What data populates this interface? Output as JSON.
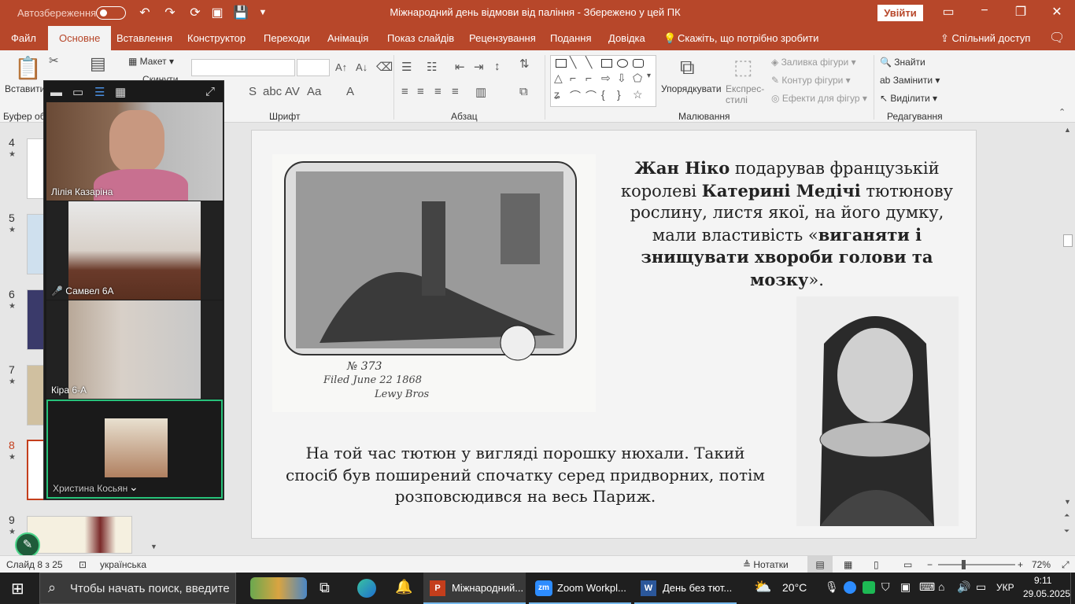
{
  "title_bar": {
    "autosave_label": "Автозбереження",
    "doc_title": "Міжнародний день відмови від паління  -  Збережено у цей ПК",
    "signin_label": "Увійти",
    "minimize": "−",
    "restore": "❐",
    "close": "✕"
  },
  "tabs": [
    "Файл",
    "Основне",
    "Вставлення",
    "Конструктор",
    "Переходи",
    "Анімація",
    "Показ слайдів",
    "Рецензування",
    "Подання",
    "Довідка"
  ],
  "tell_me": "Скажіть, що потрібно зробити",
  "share_label": "Спільний доступ",
  "ribbon": {
    "paste_label": "Вставити",
    "clipboard_group": "Буфер об",
    "layout_label": "Макет",
    "reset_label": "Скинути",
    "font_group": "Шрифт",
    "paragraph_group": "Абзац",
    "drawing_group": "Малювання",
    "arrange_label": "Упорядкувати",
    "quick_styles_label": "Експрес-стилі",
    "shape_fill": "Заливка фігури",
    "shape_outline": "Контур фігури",
    "shape_effects": "Ефекти для фігур",
    "find_label": "Знайти",
    "replace_label": "Замінити",
    "select_label": "Виділити",
    "editing_group": "Редагування"
  },
  "slide_thumbnails": [
    {
      "num": "4",
      "star": "★"
    },
    {
      "num": "5",
      "star": "★"
    },
    {
      "num": "6",
      "star": "★"
    },
    {
      "num": "7",
      "star": "★"
    },
    {
      "num": "8",
      "star": "★"
    },
    {
      "num": "9",
      "star": "★"
    }
  ],
  "zoom_participants": [
    {
      "name": "Лілія Казаріна"
    },
    {
      "name": "Самвел 6А"
    },
    {
      "name": "Кіра 6-А"
    },
    {
      "name": "Христина Косьян"
    }
  ],
  "slide": {
    "text1": {
      "p1": "Жан Ніко",
      "p2": " подарував французькій королеві ",
      "p3": "Катерині Медічі",
      "p4": " тютюнову рослину, листя якої, на його думку, мали властивість «",
      "p5": "виганяти і знищувати хвороби голови та мозку",
      "p6": "»."
    },
    "etching_caption1": "№ 373",
    "etching_caption2": "Filed June 22 1868",
    "etching_caption3": "Lewy Bros",
    "text2": "На той час тютюн у вигляді порошку нюхали. Такий спосіб був поширений спочатку серед придворних, потім розповсюдився на весь Париж."
  },
  "status_bar": {
    "slide_info": "Слайд 8 з 25",
    "language": "українська",
    "notes_label": "Нотатки",
    "zoom": "72%"
  },
  "taskbar": {
    "search_placeholder": "Чтобы начать поиск, введите",
    "apps": [
      {
        "label": "Міжнародний..."
      },
      {
        "label": "Zoom Workpl..."
      },
      {
        "label": "День без тют..."
      }
    ],
    "weather": "20°C",
    "lang": "УКР",
    "time": "9:11",
    "date": "29.05.2025"
  }
}
